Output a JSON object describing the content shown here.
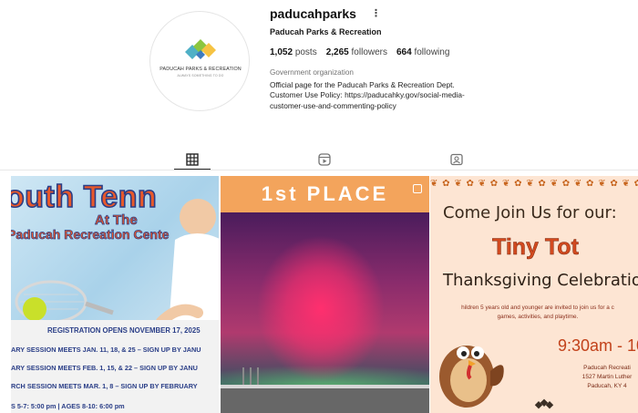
{
  "profile": {
    "username": "paducahparks",
    "more_label": "⋮",
    "full_name": "Paducah Parks & Recreation",
    "avatar": {
      "org_name": "PADUCAH PARKS & RECREATION",
      "tagline": "ALWAYS SOMETHING TO DO"
    },
    "stats": [
      {
        "value": "1,052",
        "label": "posts"
      },
      {
        "value": "2,265",
        "label": "followers"
      },
      {
        "value": "664",
        "label": "following"
      }
    ],
    "category": "Government organization",
    "bio_lines": [
      "Official page for the Paducah Parks & Recreation Dept.",
      "Customer Use Policy: https://paducahky.gov/social-media-",
      "customer-use-and-commenting-policy"
    ]
  },
  "tabs": [
    {
      "name": "posts",
      "icon": "grid-icon",
      "active": true
    },
    {
      "name": "reels",
      "icon": "reels-icon",
      "active": false
    },
    {
      "name": "tagged",
      "icon": "tagged-icon",
      "active": false
    }
  ],
  "posts": [
    {
      "title": "outh Tenn",
      "at": "At The",
      "subtitle": "Paducah Recreation Cente",
      "registration": "REGISTRATION OPENS NOVEMBER 17, 2025",
      "lines": [
        "ARY SESSION MEETS JAN. 11, 18, & 25 – SIGN UP BY JANU",
        "ARY SESSION MEETS FEB. 1, 15, & 22 – SIGN UP BY JANU",
        "RCH SESSION MEETS MAR. 1, 8 – SIGN UP BY FEBRUARY",
        "S 5-7: 5:00 pm  |  AGES 8-10: 6:00 pm"
      ]
    },
    {
      "banner": "1st PLACE"
    },
    {
      "join": "Come Join Us for our:",
      "title": "Tiny Tot",
      "subtitle": "Thanksgiving Celebration",
      "details_lines": [
        "hildren 5 years old and younger are invited to join us for a c",
        "games, activities, and playtime."
      ],
      "time": "9:30am - 10",
      "address_lines": [
        "Paducah Recreati",
        "1527 Martin Luther",
        "Paducah, KY 4"
      ]
    }
  ],
  "colors": {
    "accent_orange": "#e8582a",
    "navy": "#2a3e87",
    "banner_orange": "#f3a45c",
    "peach": "#fde5d3"
  }
}
